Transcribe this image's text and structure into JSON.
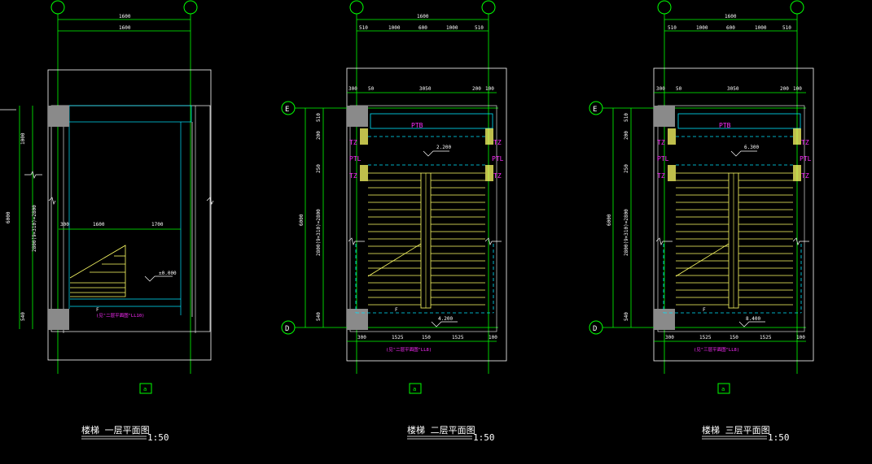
{
  "drawing": {
    "background": "#000000",
    "colors": {
      "green": "#00ff00",
      "cyan": "#00e5ff",
      "yellow": "#ffff66",
      "white": "#ffffff",
      "magenta": "#ff2cff",
      "grey": "#8a8a8a"
    }
  },
  "plans": [
    {
      "title": "楼梯 一层平面图",
      "scale": "1:50",
      "axis_bottom": "a",
      "dims_top": [
        "1600",
        "1600"
      ],
      "dims_left": [
        "1000",
        "1800",
        "2800(9×310)=2800",
        "6000",
        "540"
      ],
      "dims_mid": [
        "300",
        "1600",
        "1700"
      ],
      "level": "±0.000",
      "label_f": "F",
      "note": "(见\"二层平面图\"LL10)"
    },
    {
      "title": "楼梯 二层平面图",
      "scale": "1:50",
      "axis_left": [
        "E",
        "D"
      ],
      "axis_bottom": "a",
      "dims_top": [
        "1600",
        "510",
        "1000",
        "600",
        "1000",
        "510"
      ],
      "dims_inner_top": [
        "300",
        "50",
        "3050",
        "200",
        "100",
        "50"
      ],
      "dims_left": [
        "510",
        "200",
        "250",
        "6000",
        "2800(9×310)=2800",
        "540",
        "100"
      ],
      "dims_bottom": [
        "300",
        "1525",
        "150",
        "1525",
        "100"
      ],
      "level_top": "2.200",
      "level_bottom": "4.200",
      "tags": [
        "PTB",
        "TZ",
        "PTL",
        "TZ",
        "TZ",
        "PTL",
        "TZ"
      ],
      "label_f": "F",
      "note": "(见\"二层平面图\"LL8)"
    },
    {
      "title": "楼梯 三层平面图",
      "scale": "1:50",
      "axis_left": [
        "E",
        "D"
      ],
      "axis_bottom": "a",
      "dims_top": [
        "1600",
        "510",
        "1000",
        "600",
        "1000",
        "510"
      ],
      "dims_inner_top": [
        "300",
        "50",
        "3050",
        "200",
        "100",
        "50"
      ],
      "dims_left": [
        "510",
        "200",
        "250",
        "6000",
        "2800(9×310)=2800",
        "540",
        "100"
      ],
      "dims_bottom": [
        "300",
        "1525",
        "150",
        "1525",
        "100"
      ],
      "level_top": "6.300",
      "level_bottom": "8.400",
      "tags": [
        "PTB",
        "TZ",
        "PTL",
        "TZ",
        "TZ",
        "PTL",
        "TZ"
      ],
      "label_f": "F",
      "note": "(见\"三层平面图\"LL8)"
    }
  ]
}
